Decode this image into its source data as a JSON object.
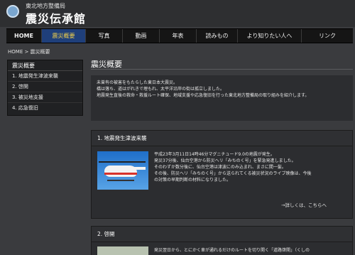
{
  "header": {
    "org": "東北地方整備局",
    "title": "震災伝承館"
  },
  "nav": [
    {
      "label": "HOME",
      "active": false
    },
    {
      "label": "震災概要",
      "active": true
    },
    {
      "label": "写真",
      "active": false
    },
    {
      "label": "動画",
      "active": false
    },
    {
      "label": "年表",
      "active": false
    },
    {
      "label": "読みもの",
      "active": false
    },
    {
      "label": "より知りたい人へ",
      "active": false
    },
    {
      "label": "リンク",
      "active": false
    }
  ],
  "breadcrumb": "HOME > 震災概要",
  "sidebar": {
    "heading": "震災概要",
    "items": [
      {
        "label": "1. 地震発生津波来襲"
      },
      {
        "label": "2. 啓開"
      },
      {
        "label": "3. 被災地支援"
      },
      {
        "label": "4. 応急復旧"
      }
    ]
  },
  "main": {
    "title": "震災概要",
    "intro": [
      "未曾有の被害をもたらした東日本大震災。",
      "橋は落ち、道はがれきで埋もれ、太平洋沿岸の街は孤立しました。",
      "地震発生直後の救命・救援ルート確保、地域支援や応急復旧を行った東北地方整備局の取り組みを紹介します。"
    ],
    "panels": [
      {
        "heading": "1. 地震発生津波来襲",
        "lines": [
          "平成23年3月11日14時46分マグニチュード9.0の地震が発生。",
          "発災37分後、仙台空港から防災ヘリ「みちのく号」を緊急発進しました。",
          "そのわずか数分後に、仙台空港は津波にのみ込まれ、まさに間一髪。",
          "その後、防災ヘリ「みちのく号」から送られてくる被災状況のライブ映像は、今後",
          "の対策の早期判断の材料になりました。"
        ],
        "more": "→詳しくは、こちらへ"
      },
      {
        "heading": "2. 啓開",
        "lines": [
          "発災翌日から、とにかく車が通れるだけのルートを切り開く「道路啓開」（くしの"
        ]
      }
    ]
  }
}
